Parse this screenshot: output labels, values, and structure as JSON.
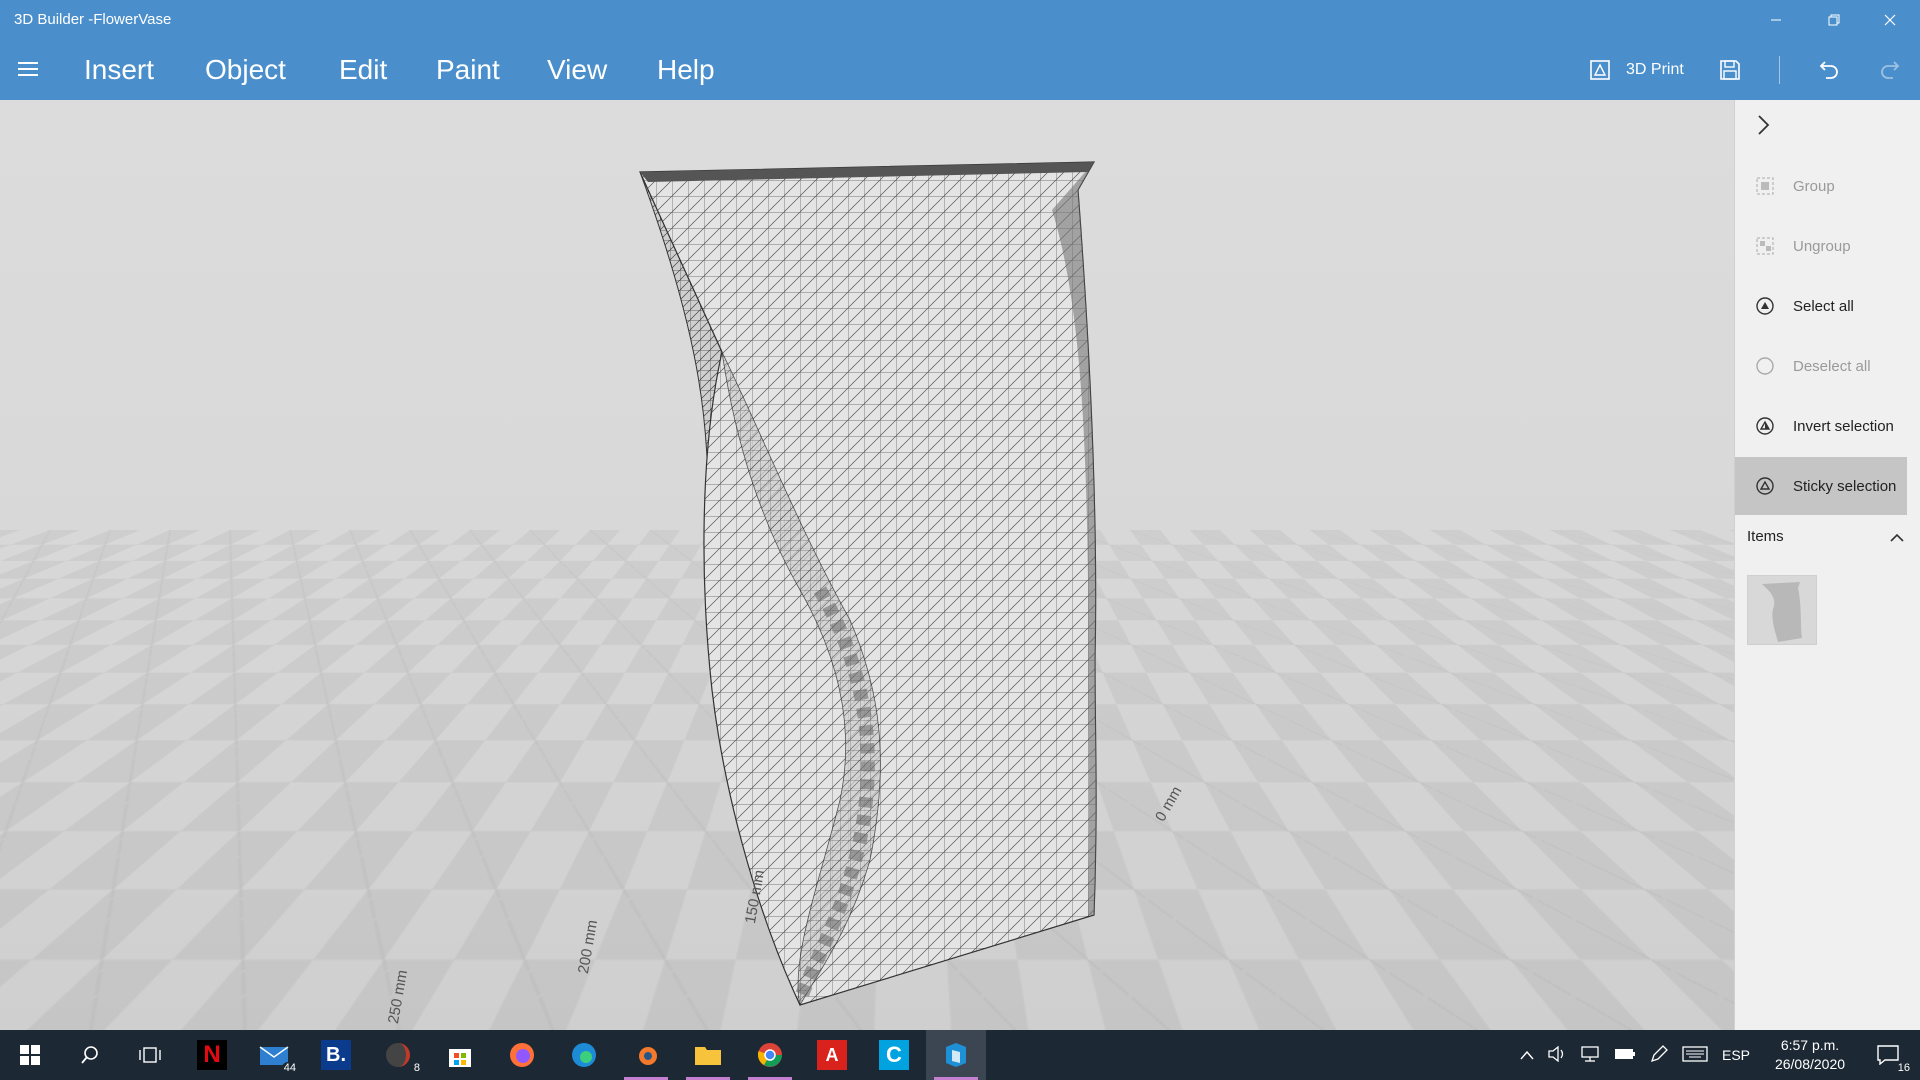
{
  "window": {
    "title": "3D Builder -FlowerVase",
    "minimize_icon": "minimize-icon",
    "restore_icon": "restore-icon",
    "close_icon": "close-icon"
  },
  "menu": {
    "items": [
      "Insert",
      "Object",
      "Edit",
      "Paint",
      "View",
      "Help"
    ],
    "print_label": "3D Print"
  },
  "viewport": {
    "dimensions": [
      "0 mm",
      "150 mm",
      "200 mm",
      "250 mm"
    ]
  },
  "panel": {
    "actions": [
      {
        "label": "Group",
        "icon": "group-icon",
        "enabled": false
      },
      {
        "label": "Ungroup",
        "icon": "ungroup-icon",
        "enabled": false
      },
      {
        "label": "Select all",
        "icon": "select-all-icon",
        "enabled": true
      },
      {
        "label": "Deselect all",
        "icon": "deselect-all-icon",
        "enabled": false
      },
      {
        "label": "Invert selection",
        "icon": "invert-selection-icon",
        "enabled": true
      },
      {
        "label": "Sticky selection",
        "icon": "sticky-selection-icon",
        "enabled": true,
        "active": true
      }
    ],
    "items_label": "Items"
  },
  "taskbar": {
    "mail_badge": "44",
    "app8_badge": "8",
    "lang": "ESP",
    "time": "6:57 p.m.",
    "date": "26/08/2020",
    "notif_count": "16"
  },
  "colors": {
    "accent": "#4a8fcc",
    "taskbar": "#1c2834",
    "panel": "#f0f0f0"
  }
}
